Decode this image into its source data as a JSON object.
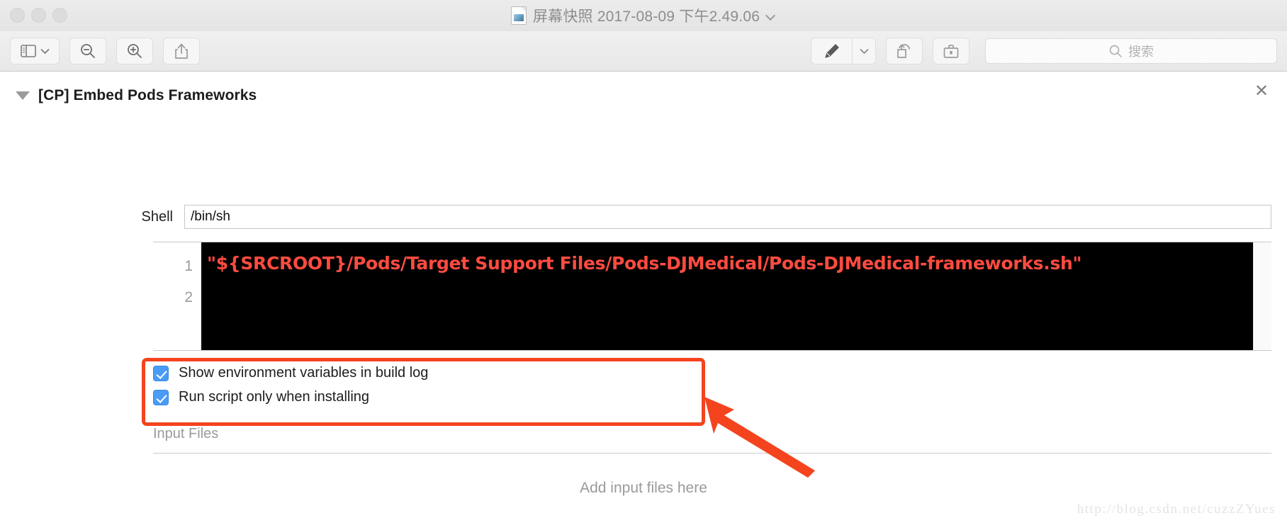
{
  "window": {
    "title": "屏幕快照 2017-08-09 下午2.49.06",
    "doc_icon": "preview-document-icon",
    "title_chevron_icon": "chevron-down-icon",
    "traffic_lights": [
      "close-light",
      "minimize-light",
      "zoom-light"
    ]
  },
  "toolbar": {
    "sidebar_icon": "sidebar-panel-icon",
    "sidebar_chevron_icon": "chevron-down-icon",
    "zoom_out_icon": "zoom-out-icon",
    "zoom_in_icon": "zoom-in-icon",
    "share_icon": "share-upload-icon",
    "markup_icon": "markup-pen-icon",
    "markup_chevron_icon": "chevron-down-icon",
    "rotate_icon": "rotate-left-icon",
    "toolbox_icon": "markup-toolbox-icon",
    "search": {
      "icon": "search-icon",
      "placeholder": "搜索",
      "value": ""
    }
  },
  "section": {
    "disclosure_icon": "disclosure-triangle-open-icon",
    "title": "[CP] Embed Pods Frameworks",
    "close_icon": "close-icon",
    "close_label": "✕"
  },
  "shell": {
    "label": "Shell",
    "value": "/bin/sh",
    "placeholder": "/bin/sh"
  },
  "editor": {
    "line_numbers": [
      "1",
      "2"
    ],
    "code": "\"${SRCROOT}/Pods/Target Support Files/Pods-DJMedical/Pods-DJMedical-frameworks.sh\"",
    "code_color": "#ff4b40",
    "background_color": "#000000"
  },
  "options": [
    {
      "label": "Show environment variables in build log",
      "checked": true
    },
    {
      "label": "Run script only when installing",
      "checked": true
    }
  ],
  "input_files": {
    "label": "Input Files",
    "empty_hint": "Add input files here"
  },
  "annotations": {
    "highlight_color": "#f4441e",
    "arrow_icon": "arrow-pointer-annotation",
    "box_icon": "highlight-box-annotation"
  },
  "watermark": {
    "text": "http://blog.csdn.net/cuzzZYues"
  }
}
